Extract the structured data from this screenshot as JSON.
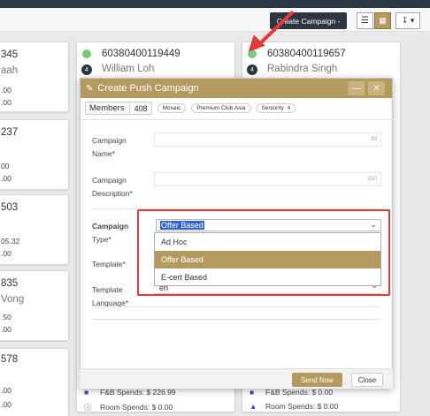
{
  "toolbar": {
    "create_campaign_label": "Create Campaign -",
    "list_view_icon": "list-icon",
    "grid_view_icon": "grid-icon",
    "filter_icon": "filter-icon"
  },
  "cards": {
    "left": [
      {
        "num": "345",
        "name": "aah",
        "line": ".00",
        "line2": ".00"
      },
      {
        "num": "237",
        "name": "",
        "line": "00",
        "line2": ".00"
      },
      {
        "num": "503",
        "name": "",
        "line": "05.32",
        "line2": ".00"
      },
      {
        "num": "835",
        "name": "Vong",
        "line": ".50",
        "line2": ".00"
      },
      {
        "num": "578",
        "name": "",
        "line": ".00",
        "line2": ".00"
      }
    ],
    "middle": {
      "num": "60380400119449",
      "name": "William Loh",
      "badge": "4",
      "fb_spends": "F&B Spends: $ 226.99",
      "room_spends": "Room Spends: $ 0.00"
    },
    "right": {
      "num": "60380400119657",
      "name": "Rabindra Singh",
      "badge": "4",
      "fb_spends": "F&B Spends: $ 0.00",
      "room_spends": "Room Spends: $ 0.00"
    }
  },
  "modal": {
    "title": "Create Push Campaign",
    "minimize_label": "—",
    "close_label": "✕",
    "members_label": "Members",
    "members_count": "408",
    "tags": [
      {
        "label": "Mosaic",
        "count": ""
      },
      {
        "label": "Premium Club Asia",
        "count": ""
      },
      {
        "label": "Seniority",
        "count": "4"
      }
    ],
    "fields": {
      "campaign_name_label_1": "Campaign",
      "campaign_name_label_2": "Name*",
      "campaign_name_limit": "99",
      "campaign_desc_label_1": "Campaign",
      "campaign_desc_label_2": "Description*",
      "campaign_desc_limit": "250",
      "campaign_type_label_1": "Campaign",
      "campaign_type_label_2": "Type*",
      "campaign_type_value": "Offer Based",
      "template_label": "Template*",
      "template_lang_label_1": "Template",
      "template_lang_label_2": "Language*",
      "template_lang_value": "en"
    },
    "dropdown_options": [
      "Ad Hoc",
      "Offer Based",
      "E-cert Based"
    ],
    "dropdown_selected": "Offer Based",
    "send_label": "Send Now",
    "close_button_label": "Close"
  },
  "colors": {
    "accent": "#b49a5e",
    "topbar": "#2b3745",
    "highlight": "#e03b3b",
    "selection": "#3264c8"
  }
}
